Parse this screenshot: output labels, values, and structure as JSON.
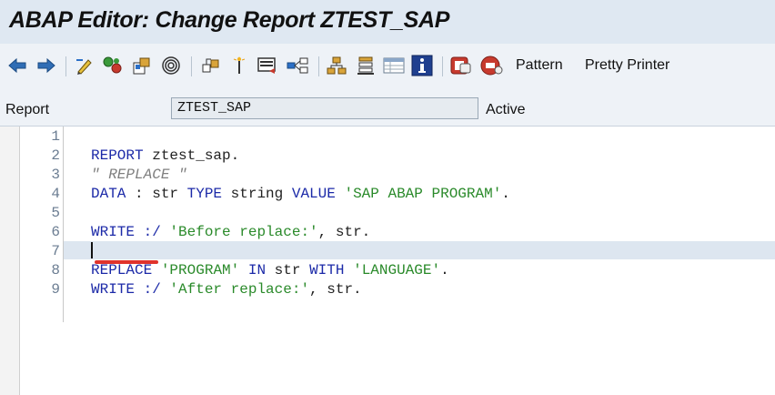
{
  "window": {
    "title": "ABAP Editor: Change Report ZTEST_SAP"
  },
  "toolbar": {
    "icons": [
      "back-arrow-icon",
      "forward-arrow-icon",
      "display-change-icon",
      "activate-icon",
      "other-object-icon",
      "where-used-icon",
      "check-icon",
      "breakpoint-icon",
      "syntax-check-icon",
      "navigate-icon",
      "hierarchy-icon",
      "stack-icon",
      "table-icon",
      "info-icon",
      "execute-icon",
      "debug-icon"
    ],
    "pattern_label": "Pattern",
    "pretty_printer_label": "Pretty Printer"
  },
  "infobar": {
    "report_label": "Report",
    "report_value": "ZTEST_SAP",
    "status": "Active"
  },
  "editor": {
    "line_numbers": [
      "1",
      "2",
      "3",
      "4",
      "5",
      "6",
      "7",
      "8",
      "9"
    ],
    "lines": [
      [],
      [
        {
          "t": "REPORT",
          "c": "kw"
        },
        {
          "t": " ztest_sap.",
          "c": ""
        }
      ],
      [
        {
          "t": "\" REPLACE \"",
          "c": "cmt"
        }
      ],
      [
        {
          "t": "DATA",
          "c": "kw"
        },
        {
          "t": " : str ",
          "c": ""
        },
        {
          "t": "TYPE",
          "c": "kw"
        },
        {
          "t": " string ",
          "c": ""
        },
        {
          "t": "VALUE",
          "c": "kw"
        },
        {
          "t": " ",
          "c": ""
        },
        {
          "t": "'SAP ABAP PROGRAM'",
          "c": "str"
        },
        {
          "t": ".",
          "c": ""
        }
      ],
      [],
      [
        {
          "t": "WRITE",
          "c": "kw"
        },
        {
          "t": " :/ ",
          "c": "kw"
        },
        {
          "t": "'Before replace:'",
          "c": "str"
        },
        {
          "t": ", str.",
          "c": ""
        }
      ],
      [],
      [
        {
          "t": "REPLACE",
          "c": "kw"
        },
        {
          "t": " ",
          "c": ""
        },
        {
          "t": "'PROGRAM'",
          "c": "str"
        },
        {
          "t": " ",
          "c": ""
        },
        {
          "t": "IN",
          "c": "kw"
        },
        {
          "t": " str ",
          "c": ""
        },
        {
          "t": "WITH",
          "c": "kw"
        },
        {
          "t": " ",
          "c": ""
        },
        {
          "t": "'LANGUAGE'",
          "c": "str"
        },
        {
          "t": ".",
          "c": ""
        }
      ],
      [
        {
          "t": "WRITE",
          "c": "kw"
        },
        {
          "t": " :/ ",
          "c": "kw"
        },
        {
          "t": "'After replace:'",
          "c": "str"
        },
        {
          "t": ", str.",
          "c": ""
        }
      ]
    ],
    "current_line": "7"
  }
}
